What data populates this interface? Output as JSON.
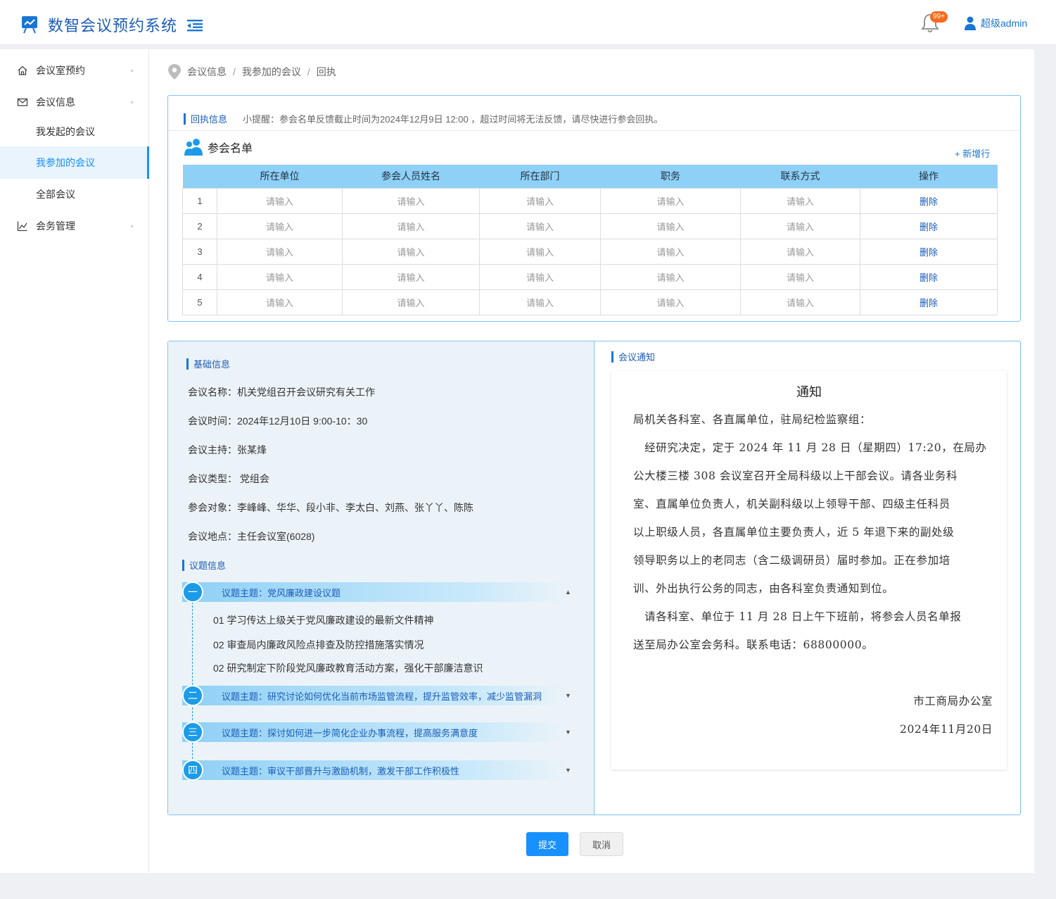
{
  "app": {
    "title": "数智会议预约系统",
    "notification_badge": "99+",
    "user_name": "超级admin"
  },
  "sidebar": {
    "items": [
      {
        "label": "会议室预约",
        "icon": "home-icon"
      },
      {
        "label": "会议信息",
        "icon": "mail-icon"
      },
      {
        "label": "会务管理",
        "icon": "line-chart-icon"
      }
    ],
    "sub_items": [
      {
        "label": "我发起的会议"
      },
      {
        "label": "我参加的会议",
        "active": true
      },
      {
        "label": "全部会议"
      }
    ],
    "arrow": "▫"
  },
  "breadcrumb": [
    "会议信息",
    "我参加的会议",
    "回执"
  ],
  "receipt": {
    "title": "回执信息",
    "tip": "小提醒：参会名单反馈截止时间为2024年12月9日 12:00 ，超过时间将无法反馈，请尽快进行参会回执。",
    "attendee_title": "参会名单",
    "add_row": "+ 新增行",
    "columns": [
      "所在单位",
      "参会人员姓名",
      "所在部门",
      "职务",
      "联系方式",
      "操作"
    ],
    "rows": [
      {
        "idx": "1",
        "placeholder": "请输入",
        "action": "删除"
      },
      {
        "idx": "2",
        "placeholder": "请输入",
        "action": "删除"
      },
      {
        "idx": "3",
        "placeholder": "请输入",
        "action": "删除"
      },
      {
        "idx": "4",
        "placeholder": "请输入",
        "action": "删除"
      },
      {
        "idx": "5",
        "placeholder": "请输入",
        "action": "删除"
      }
    ]
  },
  "basic": {
    "title": "基础信息",
    "lines": [
      "会议名称：机关党组召开会议研究有关工作",
      "会议时间：2024年12月10日  9:00-10：30",
      "会议主持：张某烽",
      "会议类型：  党组会",
      "参会对象：李峰峰、华华、段小非、李太白、刘燕、张丫丫、陈陈",
      "会议地点：主任会议室(6028)"
    ]
  },
  "topics": {
    "title": "议题信息",
    "list": [
      {
        "num": "一",
        "text": "议题主题：党风廉政建设议题",
        "caret": "▲",
        "items": [
          "01 学习传达上级关于党风廉政建设的最新文件精神",
          "02 审查局内廉政风险点排查及防控措施落实情况",
          "02 研究制定下阶段党风廉政教育活动方案，强化干部廉洁意识"
        ]
      },
      {
        "num": "二",
        "text": "议题主题：研究讨论如何优化当前市场监管流程，提升监管效率，减少监管漏洞",
        "caret": "▼"
      },
      {
        "num": "三",
        "text": "议题主题：探讨如何进一步简化企业办事流程，提高服务满意度",
        "caret": "▼"
      },
      {
        "num": "四",
        "text": "议题主题：审议干部晋升与激励机制，激发干部工作积极性",
        "caret": "▼"
      }
    ]
  },
  "notice": {
    "section_title": "会议通知",
    "title": "通知",
    "lines": [
      "局机关各科室、各直属单位，驻局纪检监察组：",
      "　经研究决定，定于 2024 年 11 月 28 日（星期四）17:20，在局办",
      "公大楼三楼 308 会议室召开全局科级以上干部会议。请各业务科",
      "室、直属单位负责人，机关副科级以上领导干部、四级主任科员",
      "以上职级人员，各直属单位主要负责人，近 5 年退下来的副处级",
      "领导职务以上的老同志（含二级调研员）届时参加。正在参加培",
      "训、外出执行公务的同志，由各科室负责通知到位。",
      "　请各科室、单位于 11 月 28 日上午下班前，将参会人员名单报",
      "送至局办公室会务科。联系电话：68800000。"
    ],
    "signature": "市工商局办公室",
    "date": "2024年11月20日"
  },
  "buttons": {
    "submit": "提交",
    "cancel": "取消"
  },
  "colors": {
    "primary": "#1890ff",
    "header_table": "#8fd0f6",
    "panel_border": "#7dc3f5"
  }
}
